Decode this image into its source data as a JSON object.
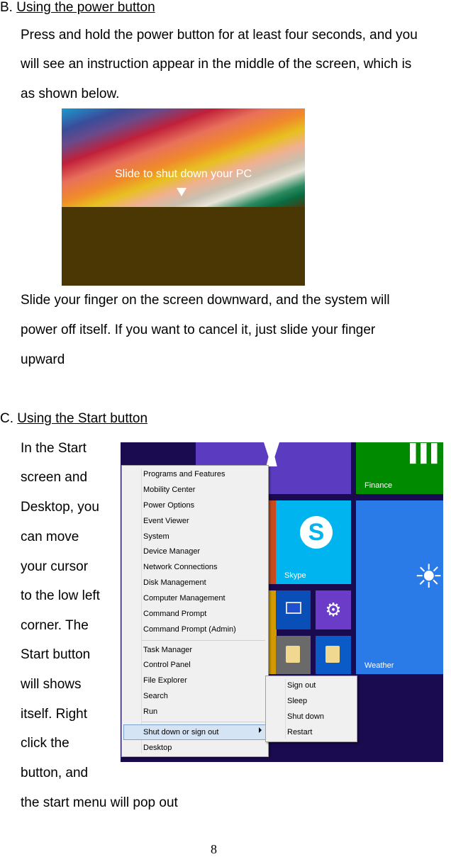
{
  "section_b": {
    "prefix": "B. ",
    "heading": "Using the power button",
    "para1": [
      "Press and hold the power button for at least four seconds, and you",
      "will see an instruction appear in the middle of the screen, which is",
      "as shown below."
    ],
    "screen_text": "Slide to shut down your PC",
    "para2": [
      "Slide your finger on the screen downward, and the system will",
      "power off itself. If you want to cancel it, just slide your finger",
      "upward"
    ]
  },
  "section_c": {
    "prefix": "C. ",
    "heading": "Using the Start button",
    "para": [
      "In the Start",
      "screen and",
      "Desktop, you",
      "can move",
      "your cursor",
      "to the low left",
      "corner. The",
      "Start button",
      "will shows",
      "itself. Right",
      "click the",
      "button, and",
      "the start menu will pop out"
    ]
  },
  "start_screen": {
    "tiles": {
      "finance": "Finance",
      "skype": "Skype",
      "weather": "Weather"
    },
    "menu_group1": [
      "Programs and Features",
      "Mobility Center",
      "Power Options",
      "Event Viewer",
      "System",
      "Device Manager",
      "Network Connections",
      "Disk Management",
      "Computer Management",
      "Command Prompt",
      "Command Prompt (Admin)"
    ],
    "menu_group2": [
      "Task Manager",
      "Control Panel",
      "File Explorer",
      "Search",
      "Run"
    ],
    "menu_selected": "Shut down or sign out",
    "menu_last": "Desktop",
    "submenu": [
      "Sign out",
      "Sleep",
      "Shut down",
      "Restart"
    ]
  },
  "page_number": "8"
}
